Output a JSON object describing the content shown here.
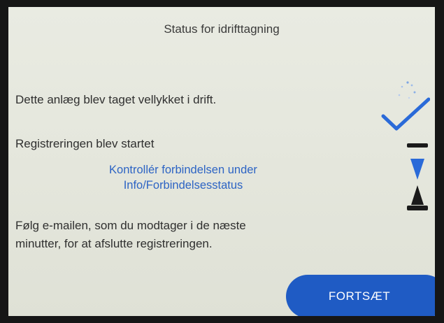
{
  "screen": {
    "title": "Status for idrifttagning",
    "commission_status": "Dette anlæg blev taget vellykket i drift.",
    "registration_status": "Registreringen blev startet",
    "connection_notice": {
      "line1": "Kontrollér forbindelsen under",
      "line2": "Info/Forbindelsesstatus"
    },
    "instruction": {
      "line1": "Følg e-mailen, som du modtager i de næste",
      "line2": "minutter, for at afslutte registreringen."
    },
    "continue_label": "FORTSÆT"
  },
  "icons": {
    "success": "checkmark-icon",
    "pending": "hourglass-icon"
  },
  "colors": {
    "accent": "#1f5bc4",
    "notice_text": "#2d64c4",
    "icon_blue": "#2a6ad8",
    "icon_dark": "#1a1a1a"
  }
}
